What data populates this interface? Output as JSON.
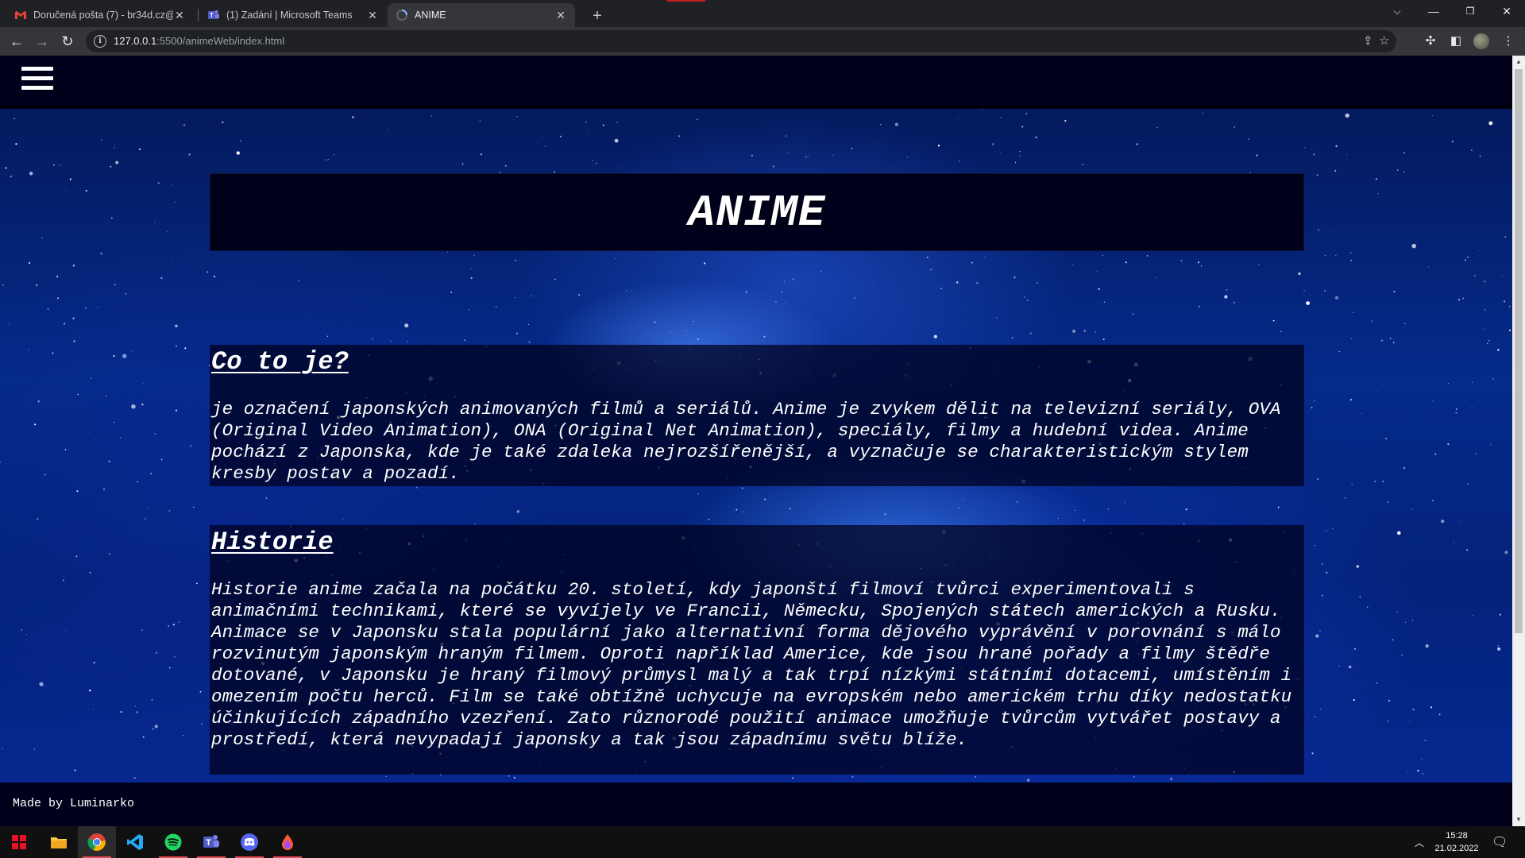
{
  "browser": {
    "tabs": [
      {
        "title": "Doručená pošta (7) - br34d.cz@g",
        "icon": "gmail-icon",
        "active": false
      },
      {
        "title": "(1) Zadání | Microsoft Teams",
        "icon": "teams-icon",
        "active": false
      },
      {
        "title": "ANIME",
        "icon": "loading-spinner-icon",
        "active": true
      }
    ],
    "url_host": "127.0.0.1",
    "url_rest": ":5500/animeWeb/index.html"
  },
  "page": {
    "title": "ANIME",
    "sections": [
      {
        "heading": "Co to je?",
        "text": "je označení japonských animovaných filmů a seriálů. Anime je zvykem dělit na televizní seriály, OVA (Original Video Animation), ONA (Original Net Animation), speciály, filmy a hudební videa. Anime pochází z Japonska, kde je také zdaleka nejrozšířenější, a vyznačuje se charakteristickým stylem kresby postav a pozadí."
      },
      {
        "heading": "Historie",
        "text": "Historie anime začala na počátku 20. století, kdy japonští filmoví tvůrci experimentovali s animačními technikami, které se vyvíjely ve Francii, Německu, Spojených státech amerických a Rusku. Animace se v Japonsku stala populární jako alternativní forma dějového vyprávění v porovnání s málo rozvinutým japonským hraným filmem. Oproti například Americe, kde jsou hrané pořady a filmy štědře dotované, v Japonsku je hraný filmový průmysl malý a tak trpí nízkými státními dotacemi, umístěním i omezením počtu herců. Film se také obtížně uchycuje na evropském nebo americkém trhu díky nedostatku účinkujících západního vzezření. Zato různorodé použití animace umožňuje tvůrcům vytvářet postavy a prostředí, která nevypadají japonsky a tak jsou západnímu světu blíže."
      }
    ],
    "footer": "Made by Luminarko"
  },
  "taskbar": {
    "time": "15:28",
    "date": "21.02.2022",
    "apps": [
      "windows-start-icon",
      "file-explorer-icon",
      "chrome-icon",
      "vscode-icon",
      "spotify-icon",
      "teams-icon",
      "discord-icon",
      "app-drop-icon"
    ]
  },
  "colors": {
    "page_bg": "#00001a",
    "sky": "#052a8a",
    "chrome_dark": "#202124",
    "chrome_toolbar": "#35363a"
  }
}
